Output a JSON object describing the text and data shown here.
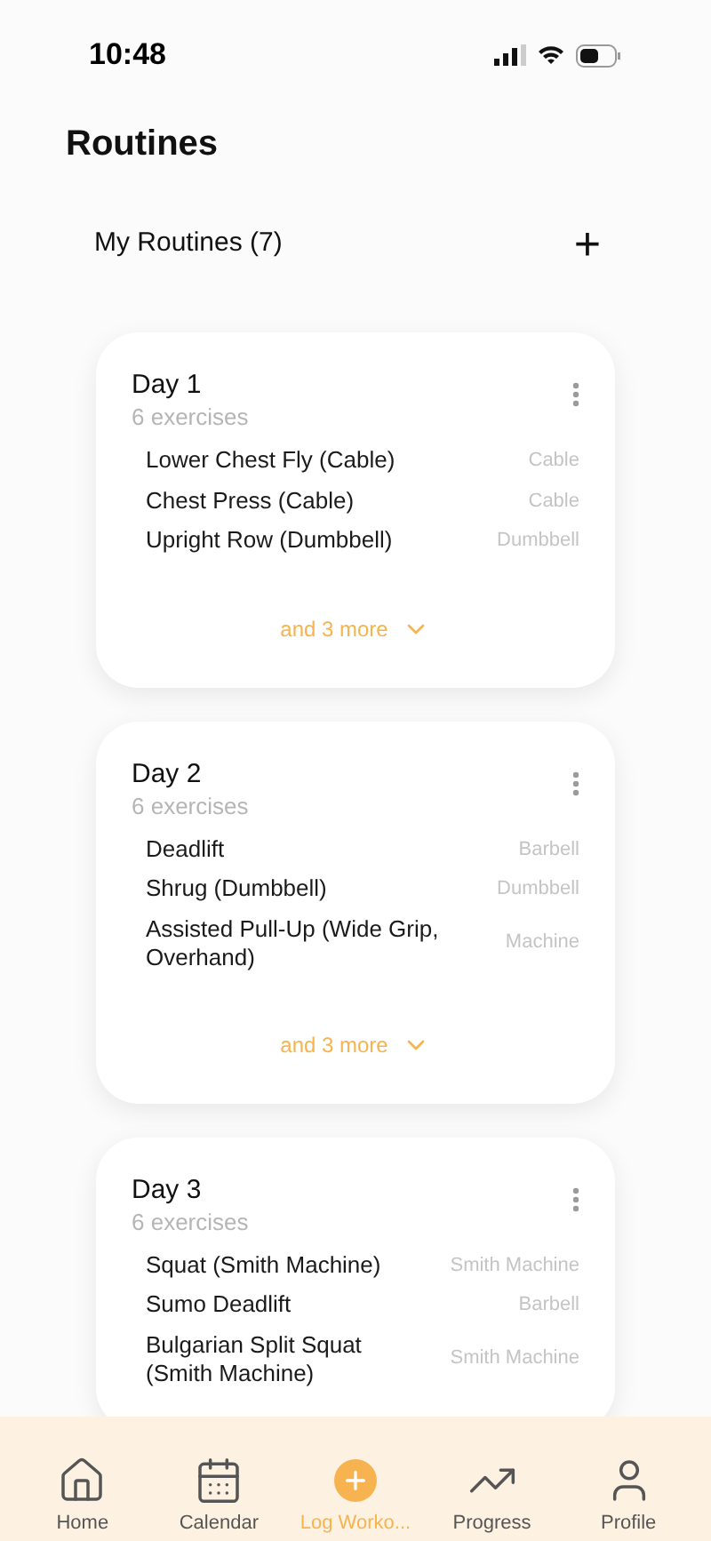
{
  "status_bar": {
    "time": "10:48"
  },
  "title": "Routines",
  "section": {
    "label": "My Routines (7)",
    "add": "+"
  },
  "routines": [
    {
      "name": "Day 1",
      "count": "6 exercises",
      "exercises": [
        {
          "name": "Lower Chest Fly (Cable)",
          "equipment": "Cable"
        },
        {
          "name": "Chest Press (Cable)",
          "equipment": "Cable"
        },
        {
          "name": "Upright Row (Dumbbell)",
          "equipment": "Dumbbell"
        }
      ],
      "more": "and 3 more"
    },
    {
      "name": "Day 2",
      "count": "6 exercises",
      "exercises": [
        {
          "name": "Deadlift",
          "equipment": "Barbell"
        },
        {
          "name": "Shrug (Dumbbell)",
          "equipment": "Dumbbell"
        },
        {
          "name": "Assisted Pull-Up (Wide Grip, Overhand)",
          "equipment": "Machine"
        }
      ],
      "more": "and 3 more"
    },
    {
      "name": "Day 3",
      "count": "6 exercises",
      "exercises": [
        {
          "name": "Squat (Smith Machine)",
          "equipment": "Smith Machine"
        },
        {
          "name": "Sumo Deadlift",
          "equipment": "Barbell"
        },
        {
          "name": "Bulgarian Split Squat (Smith Machine)",
          "equipment": "Smith Machine"
        }
      ]
    }
  ],
  "tabs": [
    {
      "label": "Home",
      "kind": "home",
      "selected": false
    },
    {
      "label": "Calendar",
      "kind": "calendar",
      "selected": false
    },
    {
      "label": "Log Worko...",
      "kind": "log",
      "selected": true
    },
    {
      "label": "Progress",
      "kind": "progress",
      "selected": false
    },
    {
      "label": "Profile",
      "kind": "profile",
      "selected": false
    }
  ]
}
